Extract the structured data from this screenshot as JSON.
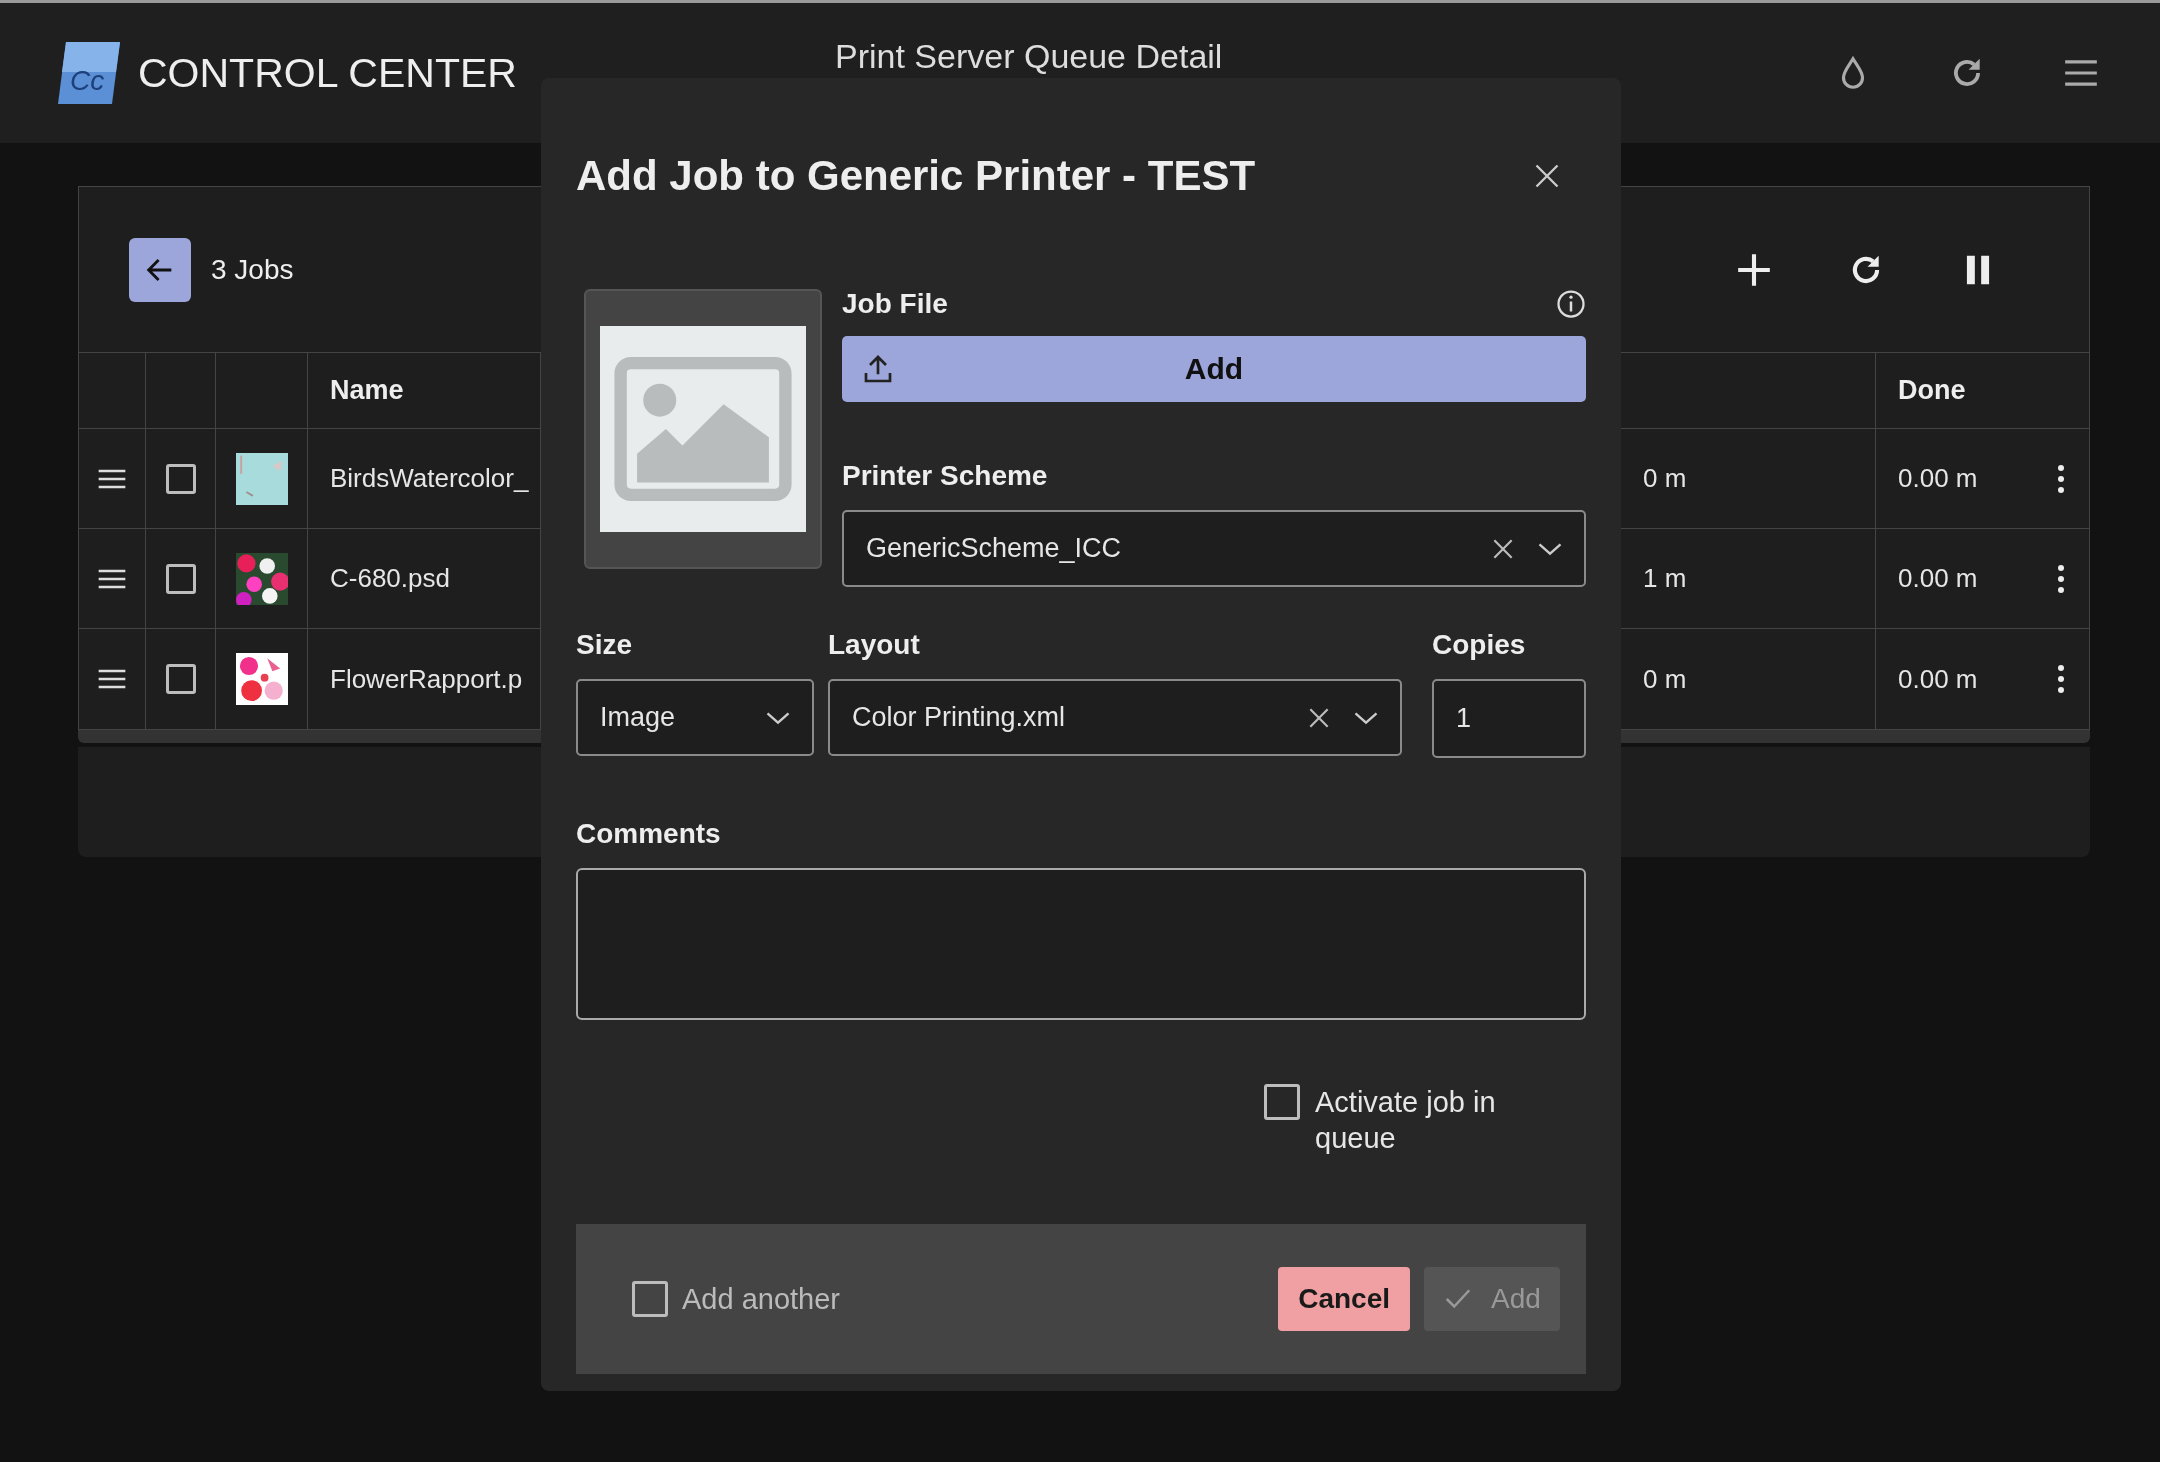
{
  "app": {
    "logo_text": "Cc",
    "name": "CONTROL CENTER",
    "page_title": "Print Server Queue Detail"
  },
  "queue": {
    "job_count": "3 Jobs",
    "columns": [
      {
        "label": "Name"
      },
      {
        "label": "Done"
      }
    ],
    "rows": [
      {
        "checked": false,
        "name": "BirdsWatercolor_",
        "column_5": "0 m",
        "done": "0.00 m"
      },
      {
        "checked": false,
        "name": "C-680.psd",
        "column_5": "1 m",
        "done": "0.00 m"
      },
      {
        "checked": false,
        "name": "FlowerRapport.p",
        "column_5": "0 m",
        "done": "0.00 m"
      }
    ]
  },
  "dialog": {
    "title": "Add Job to Generic Printer - TEST",
    "job_file": {
      "label": "Job File",
      "button": "Add"
    },
    "printer_scheme": {
      "label": "Printer Scheme",
      "value": "GenericScheme_ICC",
      "clearable": true
    },
    "size": {
      "label": "Size",
      "value": "Image",
      "clearable": false
    },
    "layout": {
      "label": "Layout",
      "value": "Color Printing.xml",
      "clearable": true
    },
    "copies": {
      "label": "Copies",
      "value": "1"
    },
    "comments": {
      "label": "Comments"
    },
    "activate": {
      "label": "Activate job in queue",
      "checked": false
    },
    "add_another": {
      "label": "Add another",
      "checked": false
    },
    "cancel": "Cancel",
    "submit": {
      "label": "Add",
      "disabled": true
    }
  }
}
